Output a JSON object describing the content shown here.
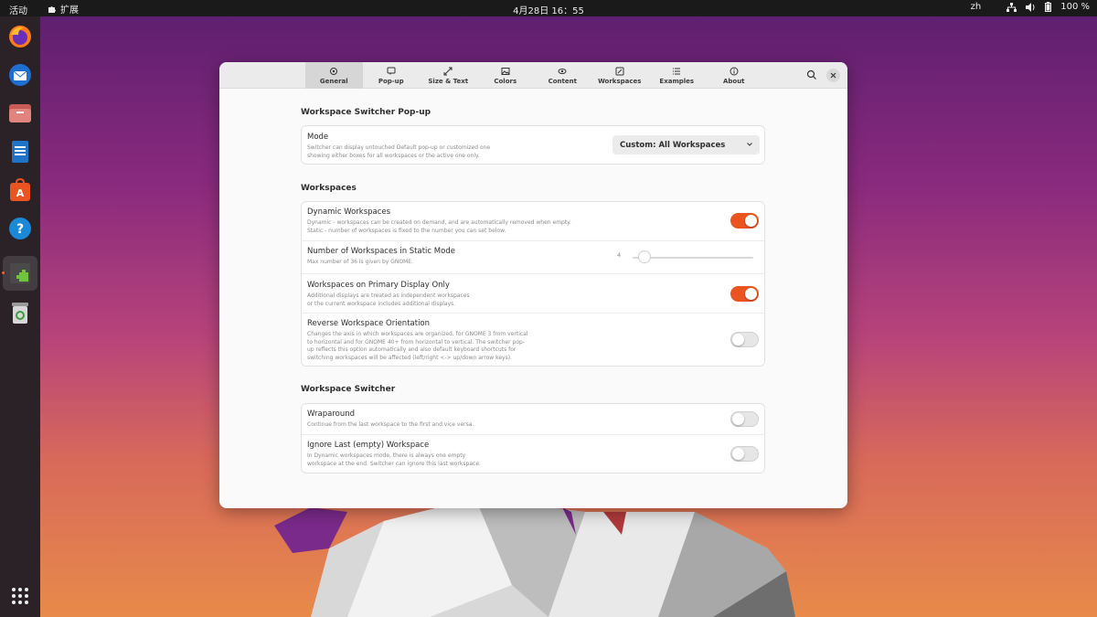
{
  "topbar": {
    "activities": "活动",
    "extensions": "扩展",
    "clock": "4月28日  16：55",
    "lang": "zh",
    "battery": "100 %"
  },
  "dock": {
    "items": [
      "firefox-icon",
      "thunderbird-icon",
      "files-icon",
      "writer-icon",
      "app-center-icon",
      "help-icon",
      "extensions-icon",
      "trash-icon"
    ],
    "show_apps": "grid-icon"
  },
  "window": {
    "tabs": [
      {
        "label": "General",
        "icon": "gear-icon"
      },
      {
        "label": "Pop-up",
        "icon": "popup-icon"
      },
      {
        "label": "Size & Text",
        "icon": "resize-icon"
      },
      {
        "label": "Colors",
        "icon": "image-icon"
      },
      {
        "label": "Content",
        "icon": "eye-icon"
      },
      {
        "label": "Workspaces",
        "icon": "edit-icon"
      },
      {
        "label": "Examples",
        "icon": "list-icon"
      },
      {
        "label": "About",
        "icon": "info-icon"
      }
    ],
    "active_tab": "General"
  },
  "popup_section": {
    "title": "Workspace Switcher Pop-up",
    "mode_title": "Mode",
    "mode_sub1": "Switcher can display untouched Default pop-up or customized one",
    "mode_sub2": "showing either boxes for all workspaces or the active one only.",
    "mode_value": "Custom: All Workspaces"
  },
  "workspaces_section": {
    "title": "Workspaces",
    "dynamic_title": "Dynamic Workspaces",
    "dynamic_sub1": "Dynamic - workspaces can be created on demand, and are automatically removed when empty.",
    "dynamic_sub2": "Static - number of workspaces is fixed to the number you can set below.",
    "dynamic_on": true,
    "number_title": "Number of Workspaces in Static Mode",
    "number_sub": "Max number of 36 is given by GNOME.",
    "number_value": "4",
    "primary_title": "Workspaces on Primary Display Only",
    "primary_sub1": "Additional displays are treated as independent workspaces",
    "primary_sub2": "or the current workspace includes additional displays.",
    "primary_on": true,
    "reverse_title": "Reverse Workspace Orientation",
    "reverse_sub1": "Changes the axis in which workspaces are organized, for GNOME 3 from vertical",
    "reverse_sub2": "to horizontal and for GNOME 40+ from horizontal to vertical. The switcher pop-",
    "reverse_sub3": "up reflects this option automatically and also default keyboard shortcuts for",
    "reverse_sub4": "switching workspaces will be affected (left/right <-> up/down arrow keys).",
    "reverse_on": false
  },
  "switcher_section": {
    "title": "Workspace Switcher",
    "wrap_title": "Wraparound",
    "wrap_sub": "Continue from the last workspace to the first and vice versa.",
    "wrap_on": false,
    "ignore_title": "Ignore Last (empty) Workspace",
    "ignore_sub1": "In Dynamic workspaces mode, there is always one empty",
    "ignore_sub2": "workspace at the end. Switcher can ignore this last workspace.",
    "ignore_on": false
  },
  "colors": {
    "accent": "#e95420",
    "topbar": "#1a1a1a",
    "dock": "#2a2226"
  }
}
